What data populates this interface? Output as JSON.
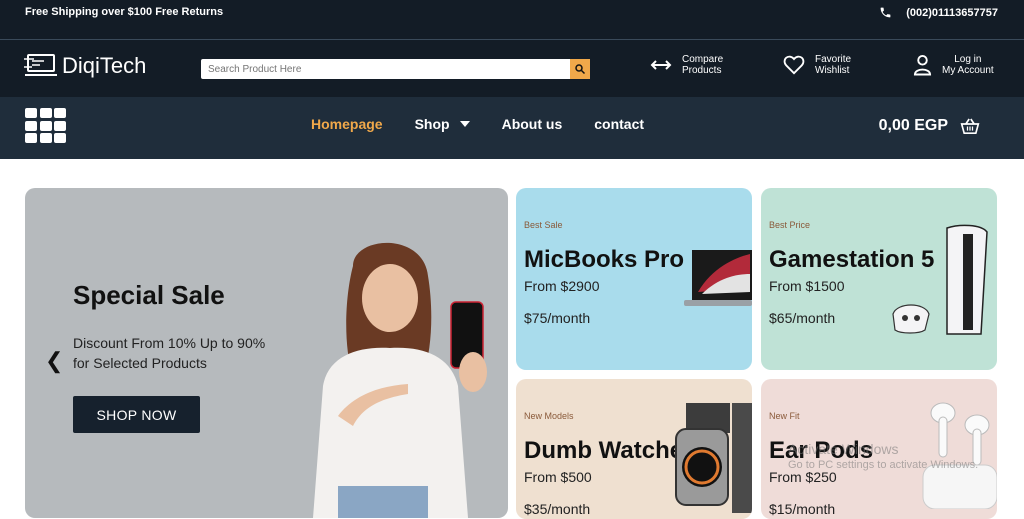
{
  "topbar": {
    "shipping_text": "Free Shipping over $100 Free Returns",
    "phone": "(002)01113657757"
  },
  "header": {
    "brand": "DiqiTech",
    "search_placeholder": "Search Product Here",
    "compare": [
      "Compare",
      "Products"
    ],
    "wishlist": [
      "Favorite",
      "Wishlist"
    ],
    "account": [
      "Log in",
      "My Account"
    ]
  },
  "nav": {
    "items": [
      "Homepage",
      "Shop",
      "About us",
      "contact"
    ],
    "cart_total": "0,00 EGP"
  },
  "hero": {
    "title": "Special Sale",
    "subtitle": "Discount From 10% Up to 90% for Selected Products",
    "button": "SHOP NOW"
  },
  "cards": [
    {
      "tag": "Best Sale",
      "name": "MicBooks Pro",
      "price": "From $2900",
      "monthly": "$75/month",
      "bg": "#a9dcec"
    },
    {
      "tag": "Best Price",
      "name": "Gamestation 5",
      "price": "From $1500",
      "monthly": "$65/month",
      "bg": "#bfe2d6"
    },
    {
      "tag": "New Models",
      "name": "Dumb Watches",
      "price": "From $500",
      "monthly": "$35/month",
      "bg": "#efe0d0"
    },
    {
      "tag": "New Fit",
      "name": "Ear Pods",
      "price": "From $250",
      "monthly": "$15/month",
      "bg": "#efdcd8"
    }
  ],
  "os_watermark": {
    "line1": "Activate Windows",
    "line2": "Go to PC settings to activate Windows."
  },
  "colors": {
    "accent": "#f0a84a",
    "dark": "#131c26",
    "nav": "#1f2d3b",
    "hero_bg": "#b6babd"
  }
}
